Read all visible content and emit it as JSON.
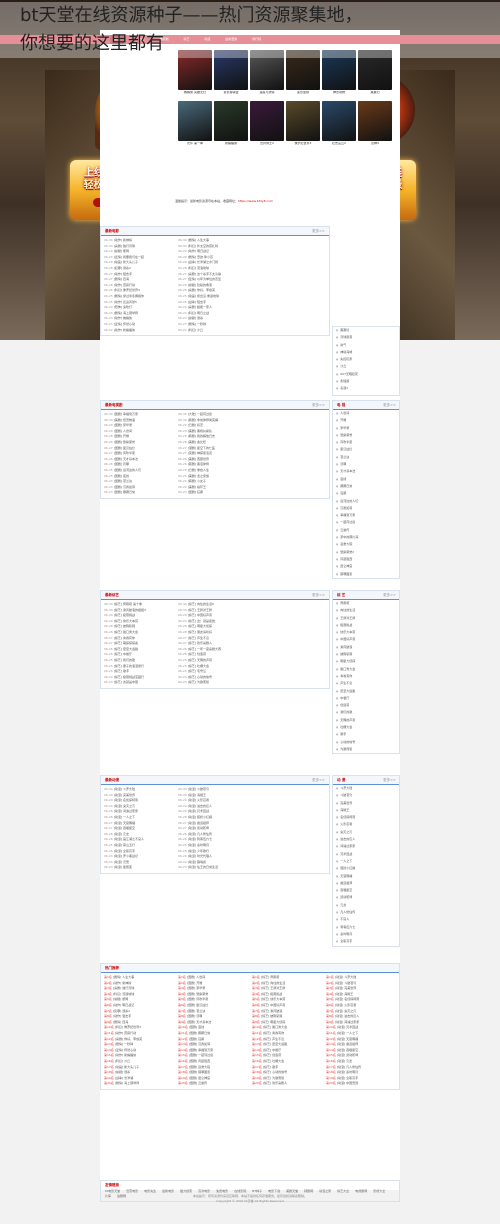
{
  "headline": {
    "line1": "bt天堂在线资源种子——热门资源聚集地，",
    "line2": "你想要的这里都有"
  },
  "promo_left": {
    "line1": "上线爆神装",
    "line2": "轻松100级",
    "button": "开始游戏"
  },
  "promo_right": {
    "line1": "上线爆神装",
    "line2": "轻松100级",
    "button": "开始游戏"
  },
  "nav": {
    "items": [
      "首页",
      "电影",
      "电视剧",
      "综艺",
      "动漫",
      "最新更新",
      "排行榜"
    ]
  },
  "movies": [
    {
      "cap": "蜘蛛侠 英雄无归"
    },
    {
      "cap": "复仇者联盟"
    },
    {
      "cap": "速度与激情"
    },
    {
      "cap": "变形金刚"
    },
    {
      "cap": "神奇动物"
    },
    {
      "cap": "黑寡妇"
    },
    {
      "cap": "光环 第一季"
    },
    {
      "cap": "新蝙蝠侠"
    },
    {
      "cap": "奇异博士2"
    },
    {
      "cap": "侏罗纪世界3"
    },
    {
      "cap": "壮志凌云2"
    },
    {
      "cap": "雷神4"
    }
  ],
  "notice": {
    "text": "温馨提示：最新电影资源尽在本站，收藏网址：",
    "url": "https://www.btdy8.com"
  },
  "section_movies": {
    "title": "最新电影",
    "more": "更多>>",
    "rows": [
      {
        "d": "06-30",
        "t": "[动作] 新神榜"
      },
      {
        "d": "06-30",
        "t": "[剧情] 人生大事"
      },
      {
        "d": "06-30",
        "t": "[喜剧] 独行月球"
      },
      {
        "d": "06-30",
        "t": "[科幻] 外太空的莫扎特"
      },
      {
        "d": "06-29",
        "t": "[悬疑] 断网"
      },
      {
        "d": "06-29",
        "t": "[动作] 明日战记"
      },
      {
        "d": "06-29",
        "t": "[爱情] 我要我们在一起"
      },
      {
        "d": "06-29",
        "t": "[剧情] 奇迹·笨小孩"
      },
      {
        "d": "06-28",
        "t": "[动画] 新大头儿子"
      },
      {
        "d": "06-28",
        "t": "[战争] 长津湖之水门桥"
      },
      {
        "d": "06-28",
        "t": "[犯罪] 误杀2"
      },
      {
        "d": "06-28",
        "t": "[科幻] 流浪地球"
      },
      {
        "d": "06-27",
        "t": "[动作] 狙击手"
      },
      {
        "d": "06-27",
        "t": "[喜剧] 这个杀手不太冷静"
      },
      {
        "d": "06-27",
        "t": "[剧情] 四海"
      },
      {
        "d": "06-27",
        "t": "[爱情] 以年为单位的恋爱"
      },
      {
        "d": "06-26",
        "t": "[动作] 雷霆行动"
      },
      {
        "d": "06-26",
        "t": "[悬疑] 隐秘的角落"
      },
      {
        "d": "06-26",
        "t": "[科幻] 侏罗纪世界3"
      },
      {
        "d": "06-26",
        "t": "[喜剧] 你好，李焕英"
      },
      {
        "d": "06-25",
        "t": "[剧情] 穿过寒冬拥抱你"
      },
      {
        "d": "06-25",
        "t": "[动画] 熊出没·重返地球"
      },
      {
        "d": "06-25",
        "t": "[动作] 反贪风暴5"
      },
      {
        "d": "06-25",
        "t": "[战争] 狙击手"
      },
      {
        "d": "06-24",
        "t": "[恐怖] 鬼吹灯"
      },
      {
        "d": "06-24",
        "t": "[喜剧] 超能一家人"
      },
      {
        "d": "06-24",
        "t": "[剧情] 海上钢琴师"
      },
      {
        "d": "06-24",
        "t": "[科幻] 明日之战"
      },
      {
        "d": "06-23",
        "t": "[动作] 蜘蛛侠"
      },
      {
        "d": "06-23",
        "t": "[悬疑] 误杀"
      },
      {
        "d": "06-23",
        "t": "[爱情] 怦然心动"
      },
      {
        "d": "06-23",
        "t": "[剧情] 一秒钟"
      },
      {
        "d": "06-22",
        "t": "[动作] 新蝙蝠侠"
      },
      {
        "d": "06-22",
        "t": "[科幻] 沙丘"
      }
    ]
  },
  "section_tv": {
    "title": "最新电视剧",
    "more": "更多>>",
    "rows": [
      {
        "d": "06-30",
        "t": "[国剧] 幸福到万家"
      },
      {
        "d": "06-30",
        "t": "[大陆] 一起同过窗"
      },
      {
        "d": "06-30",
        "t": "[美剧] 怪奇物语"
      },
      {
        "d": "06-30",
        "t": "[韩剧] 非常律师禹英禑"
      },
      {
        "d": "06-29",
        "t": "[国剧] 梦华录"
      },
      {
        "d": "06-29",
        "t": "[日剧] 初恋"
      },
      {
        "d": "06-29",
        "t": "[国剧] 人世间"
      },
      {
        "d": "06-29",
        "t": "[美剧] 黑袍纠察队"
      },
      {
        "d": "06-28",
        "t": "[国剧] 开端"
      },
      {
        "d": "06-28",
        "t": "[韩剧] 我的解放日志"
      },
      {
        "d": "06-28",
        "t": "[国剧] 警察荣誉"
      },
      {
        "d": "06-28",
        "t": "[美剧] 奥比旺"
      },
      {
        "d": "06-27",
        "t": "[国剧] 星汉灿烂"
      },
      {
        "d": "06-27",
        "t": "[港剧] 星空下的仁医"
      },
      {
        "d": "06-27",
        "t": "[国剧] 风吹半夏"
      },
      {
        "d": "06-27",
        "t": "[英剧] 神探夏洛克"
      },
      {
        "d": "06-26",
        "t": "[国剧] 天才基本法"
      },
      {
        "d": "06-26",
        "t": "[美剧] 西部世界"
      },
      {
        "d": "06-26",
        "t": "[国剧] 罚罪"
      },
      {
        "d": "06-26",
        "t": "[韩剧] 黑话律师"
      },
      {
        "d": "06-25",
        "t": "[国剧] 运河边的人们"
      },
      {
        "d": "06-25",
        "t": "[日剧] 重启人生"
      },
      {
        "d": "06-25",
        "t": "[国剧] 底线"
      },
      {
        "d": "06-25",
        "t": "[美剧] 龙之家族"
      },
      {
        "d": "06-24",
        "t": "[国剧] 苍兰诀"
      },
      {
        "d": "06-24",
        "t": "[韩剧] 小女子"
      },
      {
        "d": "06-24",
        "t": "[国剧] 沉香如屑"
      },
      {
        "d": "06-24",
        "t": "[美剧] 指环王"
      },
      {
        "d": "06-23",
        "t": "[国剧] 卿卿日常"
      },
      {
        "d": "06-23",
        "t": "[国剧] 狂飙"
      }
    ]
  },
  "section_variety": {
    "title": "最新综艺",
    "more": "更多>>",
    "rows": [
      {
        "d": "06-30",
        "t": "[综艺] 奔跑吧 第十季"
      },
      {
        "d": "06-30",
        "t": "[综艺] 向往的生活6"
      },
      {
        "d": "06-30",
        "t": "[综艺] 乘风破浪的姐姐3"
      },
      {
        "d": "06-30",
        "t": "[综艺] 王牌对王牌"
      },
      {
        "d": "06-29",
        "t": "[综艺] 极限挑战"
      },
      {
        "d": "06-29",
        "t": "[综艺] 中国好声音"
      },
      {
        "d": "06-29",
        "t": "[综艺] 快乐大本营"
      },
      {
        "d": "06-29",
        "t": "[综艺] 这！就是街舞"
      },
      {
        "d": "06-28",
        "t": "[综艺] 披荆斩棘"
      },
      {
        "d": "06-28",
        "t": "[综艺] 明星大侦探"
      },
      {
        "d": "06-28",
        "t": "[综艺] 脱口秀大会"
      },
      {
        "d": "06-28",
        "t": "[综艺] 朋友请听好"
      },
      {
        "d": "06-27",
        "t": "[综艺] 青春有你"
      },
      {
        "d": "06-27",
        "t": "[综艺] 声生不息"
      },
      {
        "d": "06-27",
        "t": "[综艺] 萌探探探案"
      },
      {
        "d": "06-27",
        "t": "[综艺] 欢乐喜剧人"
      },
      {
        "d": "06-26",
        "t": "[综艺] 密室大逃脱"
      },
      {
        "d": "06-26",
        "t": "[综艺] 一年一度喜剧大赛"
      },
      {
        "d": "06-26",
        "t": "[综艺] 中餐厅"
      },
      {
        "d": "06-26",
        "t": "[综艺] 创造营"
      },
      {
        "d": "06-25",
        "t": "[综艺] 我们的歌"
      },
      {
        "d": "06-25",
        "t": "[综艺] 天赐的声音"
      },
      {
        "d": "06-25",
        "t": "[综艺] 妻子的浪漫旅行"
      },
      {
        "d": "06-25",
        "t": "[综艺] 吐槽大会"
      },
      {
        "d": "06-24",
        "t": "[综艺] 歌手"
      },
      {
        "d": "06-24",
        "t": "[综艺] 毛雪汪"
      },
      {
        "d": "06-24",
        "t": "[综艺] 极限挑战宝藏行"
      },
      {
        "d": "06-24",
        "t": "[综艺] 心动的信号"
      },
      {
        "d": "06-23",
        "t": "[综艺] 这就是中国"
      },
      {
        "d": "06-23",
        "t": "[综艺] 为歌而赞"
      }
    ]
  },
  "section_anime": {
    "title": "最新动漫",
    "more": "更多>>",
    "rows": [
      {
        "d": "06-30",
        "t": "[动漫] 斗罗大陆"
      },
      {
        "d": "06-30",
        "t": "[动漫] 斗破苍穹"
      },
      {
        "d": "06-30",
        "t": "[动漫] 完美世界"
      },
      {
        "d": "06-30",
        "t": "[动漫] 海贼王"
      },
      {
        "d": "06-29",
        "t": "[动漫] 名侦探柯南"
      },
      {
        "d": "06-29",
        "t": "[动漫] 火影忍者"
      },
      {
        "d": "06-29",
        "t": "[动漫] 鬼灭之刃"
      },
      {
        "d": "06-29",
        "t": "[动漫] 进击的巨人"
      },
      {
        "d": "06-28",
        "t": "[动漫] 间谍过家家"
      },
      {
        "d": "06-28",
        "t": "[动漫] 咒术回战"
      },
      {
        "d": "06-28",
        "t": "[动漫] 一人之下"
      },
      {
        "d": "06-28",
        "t": "[动漫] 狐妖小红娘"
      },
      {
        "d": "06-27",
        "t": "[动漫] 天官赐福"
      },
      {
        "d": "06-27",
        "t": "[动漫] 魔道祖师"
      },
      {
        "d": "06-27",
        "t": "[动漫] 吞噬星空"
      },
      {
        "d": "06-27",
        "t": "[动漫] 武动乾坤"
      },
      {
        "d": "06-26",
        "t": "[动漫] 元龙"
      },
      {
        "d": "06-26",
        "t": "[动漫] 凡人修仙传"
      },
      {
        "d": "06-26",
        "t": "[动漫] 画江湖之不良人"
      },
      {
        "d": "06-26",
        "t": "[动漫] 刺客伍六七"
      },
      {
        "d": "06-25",
        "t": "[动漫] 雾山五行"
      },
      {
        "d": "06-25",
        "t": "[动漫] 秦时明月"
      },
      {
        "d": "06-25",
        "t": "[动漫] 全职高手"
      },
      {
        "d": "06-25",
        "t": "[动漫] 少年歌行"
      },
      {
        "d": "06-24",
        "t": "[动漫] 罗小黑战记"
      },
      {
        "d": "06-24",
        "t": "[动漫] 时光代理人"
      },
      {
        "d": "06-24",
        "t": "[动漫] 灵笼"
      },
      {
        "d": "06-24",
        "t": "[动漫] 镇魂街"
      },
      {
        "d": "06-23",
        "t": "[动漫] 星辰变"
      },
      {
        "d": "06-23",
        "t": "[动漫] 仙王的日常生活"
      }
    ]
  },
  "side1": {
    "title": "",
    "items": [
      "黑寡妇",
      "月球陨落",
      "尚气",
      "神秘海域",
      "失控玩家",
      "沙丘",
      "007无暇赴死",
      "永恒族",
      "毒液2"
    ]
  },
  "side2": {
    "title": "电 视",
    "more": "更多>>",
    "items": [
      "人世间",
      "开端",
      "梦华录",
      "警察荣誉",
      "风吹半夏",
      "星汉灿烂",
      "苍兰诀",
      "罚罪",
      "天才基本法",
      "底线",
      "卿卿日常",
      "狂飙",
      "运河边的人们",
      "沉香如屑",
      "幸福到万家",
      "一起同过窗",
      "云襄传",
      "梦中的那片海",
      "县委大院",
      "警察荣誉2",
      "风起陇西",
      "昆仑神宫",
      "猎罪图鉴"
    ]
  },
  "side3": {
    "title": "综 艺",
    "more": "更多>>",
    "items": [
      "奔跑吧",
      "向往的生活",
      "王牌对王牌",
      "极限挑战",
      "快乐大本营",
      "中国好声音",
      "乘风破浪",
      "披荆斩棘",
      "明星大侦探",
      "脱口秀大会",
      "青春有你",
      "声生不息",
      "密室大逃脱",
      "中餐厅",
      "创造营",
      "我们的歌",
      "天赐的声音",
      "吐槽大会",
      "歌手",
      "心动的信号",
      "为歌而赞"
    ]
  },
  "side4": {
    "title": "动 漫",
    "more": "更多>>",
    "items": [
      "斗罗大陆",
      "斗破苍穹",
      "完美世界",
      "海贼王",
      "名侦探柯南",
      "火影忍者",
      "鬼灭之刃",
      "进击的巨人",
      "间谍过家家",
      "咒术回战",
      "一人之下",
      "狐妖小红娘",
      "天官赐福",
      "魔道祖师",
      "吞噬星空",
      "武动乾坤",
      "元龙",
      "凡人修仙传",
      "不良人",
      "刺客伍六七",
      "秦时明月",
      "全职高手"
    ]
  },
  "hot": {
    "title": "热门推荐",
    "rows": [
      {
        "d": "第1名",
        "t": "[剧情] 人生大事"
      },
      {
        "d": "第1名",
        "t": "[国剧] 人世间"
      },
      {
        "d": "第1名",
        "t": "[综艺] 奔跑吧"
      },
      {
        "d": "第1名",
        "t": "[动漫] 斗罗大陆"
      },
      {
        "d": "第2名",
        "t": "[动作] 新神榜"
      },
      {
        "d": "第2名",
        "t": "[国剧] 开端"
      },
      {
        "d": "第2名",
        "t": "[综艺] 向往的生活"
      },
      {
        "d": "第2名",
        "t": "[动漫] 斗破苍穹"
      },
      {
        "d": "第3名",
        "t": "[喜剧] 独行月球"
      },
      {
        "d": "第3名",
        "t": "[国剧] 梦华录"
      },
      {
        "d": "第3名",
        "t": "[综艺] 王牌对王牌"
      },
      {
        "d": "第3名",
        "t": "[动漫] 完美世界"
      },
      {
        "d": "第4名",
        "t": "[科幻] 流浪地球"
      },
      {
        "d": "第4名",
        "t": "[国剧] 警察荣誉"
      },
      {
        "d": "第4名",
        "t": "[综艺] 极限挑战"
      },
      {
        "d": "第4名",
        "t": "[动漫] 海贼王"
      },
      {
        "d": "第5名",
        "t": "[悬疑] 断网"
      },
      {
        "d": "第5名",
        "t": "[国剧] 风吹半夏"
      },
      {
        "d": "第5名",
        "t": "[综艺] 快乐大本营"
      },
      {
        "d": "第5名",
        "t": "[动漫] 名侦探柯南"
      },
      {
        "d": "第6名",
        "t": "[动作] 明日战记"
      },
      {
        "d": "第6名",
        "t": "[国剧] 星汉灿烂"
      },
      {
        "d": "第6名",
        "t": "[综艺] 中国好声音"
      },
      {
        "d": "第6名",
        "t": "[动漫] 火影忍者"
      },
      {
        "d": "第7名",
        "t": "[犯罪] 误杀2"
      },
      {
        "d": "第7名",
        "t": "[国剧] 苍兰诀"
      },
      {
        "d": "第7名",
        "t": "[综艺] 乘风破浪"
      },
      {
        "d": "第7名",
        "t": "[动漫] 鬼灭之刃"
      },
      {
        "d": "第8名",
        "t": "[动作] 狙击手"
      },
      {
        "d": "第8名",
        "t": "[国剧] 罚罪"
      },
      {
        "d": "第8名",
        "t": "[综艺] 披荆斩棘"
      },
      {
        "d": "第8名",
        "t": "[动漫] 进击的巨人"
      },
      {
        "d": "第9名",
        "t": "[剧情] 四海"
      },
      {
        "d": "第9名",
        "t": "[国剧] 天才基本法"
      },
      {
        "d": "第9名",
        "t": "[综艺] 明星大侦探"
      },
      {
        "d": "第9名",
        "t": "[动漫] 间谍过家家"
      },
      {
        "d": "第10名",
        "t": "[科幻] 侏罗纪世界3"
      },
      {
        "d": "第10名",
        "t": "[国剧] 底线"
      },
      {
        "d": "第10名",
        "t": "[综艺] 脱口秀大会"
      },
      {
        "d": "第10名",
        "t": "[动漫] 咒术回战"
      },
      {
        "d": "第11名",
        "t": "[动作] 雷霆行动"
      },
      {
        "d": "第11名",
        "t": "[国剧] 卿卿日常"
      },
      {
        "d": "第11名",
        "t": "[综艺] 青春有你"
      },
      {
        "d": "第11名",
        "t": "[动漫] 一人之下"
      },
      {
        "d": "第12名",
        "t": "[喜剧] 你好，李焕英"
      },
      {
        "d": "第12名",
        "t": "[国剧] 狂飙"
      },
      {
        "d": "第12名",
        "t": "[综艺] 声生不息"
      },
      {
        "d": "第12名",
        "t": "[动漫] 天官赐福"
      },
      {
        "d": "第13名",
        "t": "[剧情] 一秒钟"
      },
      {
        "d": "第13名",
        "t": "[国剧] 沉香如屑"
      },
      {
        "d": "第13名",
        "t": "[综艺] 密室大逃脱"
      },
      {
        "d": "第13名",
        "t": "[动漫] 魔道祖师"
      },
      {
        "d": "第14名",
        "t": "[爱情] 怦然心动"
      },
      {
        "d": "第14名",
        "t": "[国剧] 幸福到万家"
      },
      {
        "d": "第14名",
        "t": "[综艺] 中餐厅"
      },
      {
        "d": "第14名",
        "t": "[动漫] 吞噬星空"
      },
      {
        "d": "第15名",
        "t": "[动作] 新蝙蝠侠"
      },
      {
        "d": "第15名",
        "t": "[国剧] 一起同过窗"
      },
      {
        "d": "第15名",
        "t": "[综艺] 创造营"
      },
      {
        "d": "第15名",
        "t": "[动漫] 武动乾坤"
      },
      {
        "d": "第16名",
        "t": "[科幻] 沙丘"
      },
      {
        "d": "第16名",
        "t": "[国剧] 风起陇西"
      },
      {
        "d": "第16名",
        "t": "[综艺] 吐槽大会"
      },
      {
        "d": "第16名",
        "t": "[动漫] 元龙"
      },
      {
        "d": "第17名",
        "t": "[动画] 新大头儿子"
      },
      {
        "d": "第17名",
        "t": "[国剧] 县委大院"
      },
      {
        "d": "第17名",
        "t": "[综艺] 歌手"
      },
      {
        "d": "第17名",
        "t": "[动漫] 凡人修仙传"
      },
      {
        "d": "第18名",
        "t": "[悬疑] 误杀"
      },
      {
        "d": "第18名",
        "t": "[国剧] 猎罪图鉴"
      },
      {
        "d": "第18名",
        "t": "[综艺] 心动的信号"
      },
      {
        "d": "第18名",
        "t": "[动漫] 秦时明月"
      },
      {
        "d": "第19名",
        "t": "[战争] 长津湖"
      },
      {
        "d": "第19名",
        "t": "[国剧] 昆仑神宫"
      },
      {
        "d": "第19名",
        "t": "[综艺] 为歌而赞"
      },
      {
        "d": "第19名",
        "t": "[动漫] 全职高手"
      },
      {
        "d": "第20名",
        "t": "[剧情] 海上钢琴师"
      },
      {
        "d": "第20名",
        "t": "[国剧] 云襄传"
      },
      {
        "d": "第20名",
        "t": "[综艺] 欢乐喜剧人"
      },
      {
        "d": "第20名",
        "t": "[动漫] 中国奇谭"
      }
    ]
  },
  "links": {
    "title": "友情链接",
    "items": [
      "bt电影天堂",
      "迅雷电影",
      "电影先生",
      "最新电影",
      "磁力搜索",
      "高清电影",
      "免费电影",
      "在线影院",
      "BT种子",
      "电影下载",
      "美剧天堂",
      "韩剧网",
      "动漫之家",
      "综艺大全",
      "电视剧网",
      "影视大全",
      "片库",
      "追剧网"
    ]
  },
  "footer": {
    "line1": "本站提示：所有资源均来自互联网，本站不提供任何存储服务。如有侵权请联系删除。",
    "line2": "Copyright © 2022 bt天堂 All Rights Reserved"
  },
  "colors": {
    "nav": "#d9545f",
    "accent": "#5c8fd6",
    "title_red": "#cc0000"
  }
}
